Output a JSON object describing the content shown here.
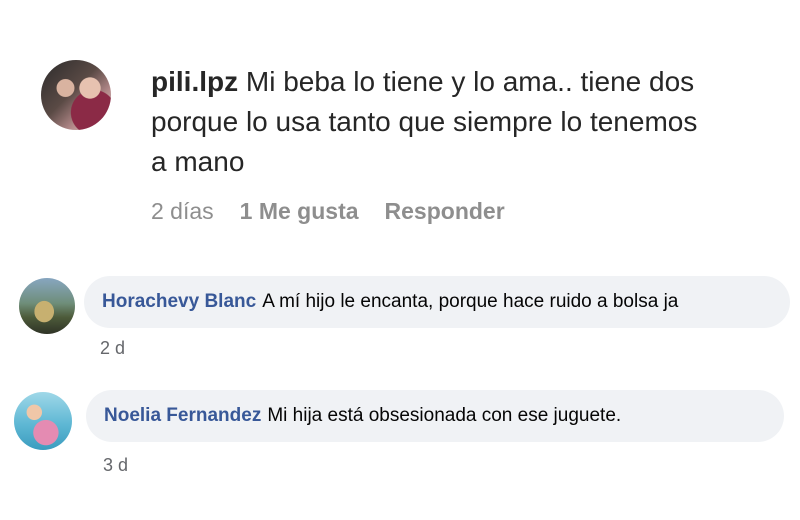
{
  "ig_comment": {
    "username": "pili.lpz",
    "text": "Mi beba lo tiene y lo ama.. tiene dos porque lo usa tanto que siempre lo tenemos a mano",
    "time": "2 días",
    "likes": "1 Me gusta",
    "reply": "Responder"
  },
  "fb_comments": [
    {
      "name": "Horachevy Blanc",
      "text": "A mí hijo le encanta, porque hace ruido a bolsa ja",
      "time": "2 d"
    },
    {
      "name": "Noelia Fernandez",
      "text": "Mi hija está obsesionada con ese juguete.",
      "time": "3 d"
    }
  ],
  "colors": {
    "fb_name": "#385898",
    "bubble": "#f0f2f5",
    "meta": "#8e8e8e"
  }
}
